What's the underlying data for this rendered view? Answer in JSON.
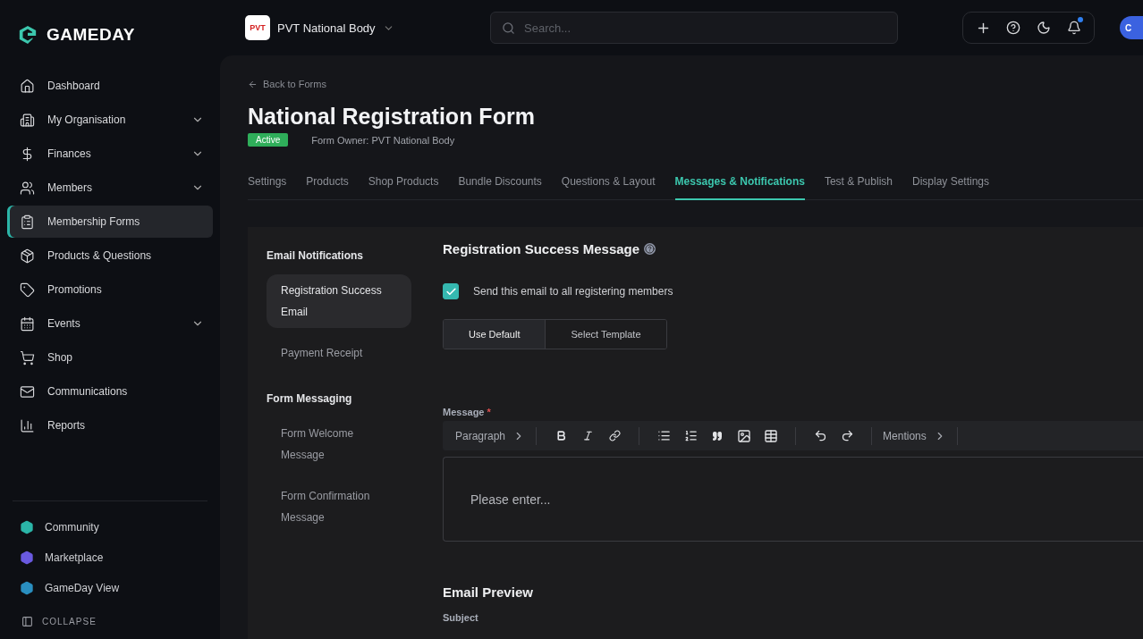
{
  "brand": {
    "name": "GAMEDAY"
  },
  "org": {
    "badge": "PVT",
    "name": "PVT National Body"
  },
  "search": {
    "placeholder": "Search..."
  },
  "avatar": {
    "initials": "C"
  },
  "notifications": {
    "unread": true
  },
  "sidebar": {
    "items": [
      {
        "label": "Dashboard",
        "expandable": false,
        "selected": false
      },
      {
        "label": "My Organisation",
        "expandable": true,
        "selected": false
      },
      {
        "label": "Finances",
        "expandable": true,
        "selected": false
      },
      {
        "label": "Members",
        "expandable": true,
        "selected": false
      },
      {
        "label": "Membership Forms",
        "expandable": false,
        "selected": true
      },
      {
        "label": "Products & Questions",
        "expandable": false,
        "selected": false
      },
      {
        "label": "Promotions",
        "expandable": false,
        "selected": false
      },
      {
        "label": "Events",
        "expandable": true,
        "selected": false
      },
      {
        "label": "Shop",
        "expandable": false,
        "selected": false
      },
      {
        "label": "Communications",
        "expandable": false,
        "selected": false
      },
      {
        "label": "Reports",
        "expandable": false,
        "selected": false
      }
    ],
    "apps": [
      {
        "label": "Community",
        "color": "#2bb5a8"
      },
      {
        "label": "Marketplace",
        "color": "#6a5ae0"
      },
      {
        "label": "GameDay View",
        "color": "#2a8fc0"
      }
    ],
    "collapse": "COLLAPSE"
  },
  "page": {
    "back": "Back to Forms",
    "title": "National Registration Form",
    "status": "Active",
    "owner": "Form Owner: PVT National Body"
  },
  "tabs": [
    {
      "label": "Settings",
      "selected": false
    },
    {
      "label": "Products",
      "selected": false
    },
    {
      "label": "Shop Products",
      "selected": false
    },
    {
      "label": "Bundle Discounts",
      "selected": false
    },
    {
      "label": "Questions & Layout",
      "selected": false
    },
    {
      "label": "Messages & Notifications",
      "selected": true
    },
    {
      "label": "Test & Publish",
      "selected": false
    },
    {
      "label": "Display Settings",
      "selected": false
    }
  ],
  "subnav": [
    {
      "heading": "Email Notifications",
      "items": [
        {
          "label": "Registration Success Email",
          "selected": true
        },
        {
          "label": "Payment Receipt",
          "selected": false
        }
      ]
    },
    {
      "heading": "Form Messaging",
      "items": [
        {
          "label": "Form Welcome Message",
          "selected": false
        },
        {
          "label": "Form Confirmation Message",
          "selected": false
        }
      ]
    }
  ],
  "content": {
    "heading": "Registration Success Message",
    "send_all": {
      "label": "Send this email to all registering members",
      "checked": true
    },
    "template_options": [
      {
        "label": "Use Default",
        "selected": true
      },
      {
        "label": "Select Template",
        "selected": false
      }
    ],
    "message": {
      "label": "Message",
      "required_mark": "*",
      "placeholder": "Please enter...",
      "toolbar": {
        "block": "Paragraph",
        "mentions": "Mentions"
      }
    },
    "preview": {
      "heading": "Email Preview",
      "subject_label": "Subject"
    }
  }
}
